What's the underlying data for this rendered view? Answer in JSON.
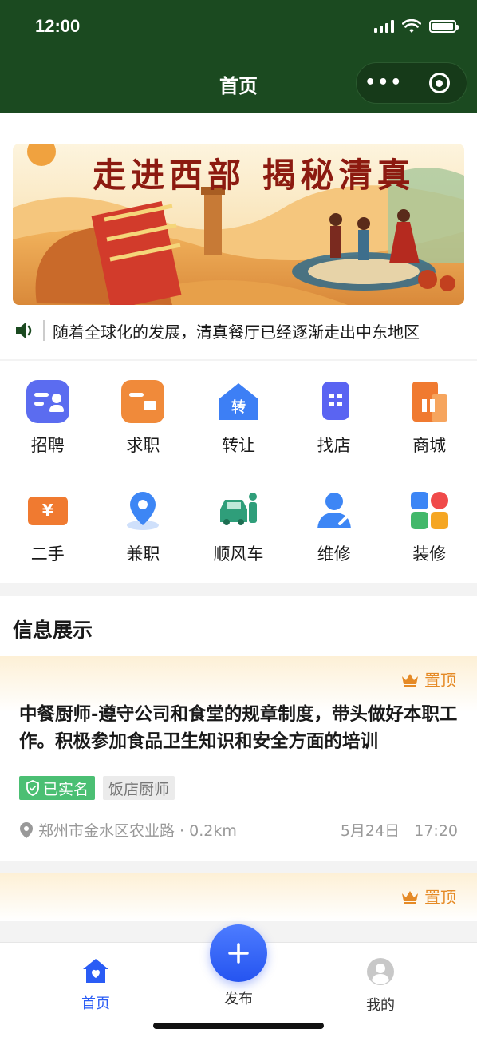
{
  "status_bar": {
    "time": "12:00"
  },
  "nav": {
    "title": "首页"
  },
  "banner": {
    "title": "走进西部 揭秘清真"
  },
  "notice": {
    "text": "随着全球化的发展，清真餐厅已经逐渐走出中东地区"
  },
  "categories": [
    {
      "label": "招聘",
      "icon": "recruit-card-icon",
      "color": "#5b6cf0"
    },
    {
      "label": "求职",
      "icon": "job-seek-briefcase-icon",
      "color": "#f08a3a"
    },
    {
      "label": "转让",
      "icon": "transfer-house-icon",
      "color": "#3d7ff5",
      "badge": "转"
    },
    {
      "label": "找店",
      "icon": "find-shop-phone-icon",
      "color": "#5a64f2"
    },
    {
      "label": "商城",
      "icon": "mall-building-icon",
      "color": "#f07a30"
    },
    {
      "label": "二手",
      "icon": "second-hand-ticket-icon",
      "color": "#f07a30",
      "badge": "¥"
    },
    {
      "label": "兼职",
      "icon": "part-time-location-icon",
      "color": "#3d86f5"
    },
    {
      "label": "顺风车",
      "icon": "rideshare-car-icon",
      "color": "#2f9e7a"
    },
    {
      "label": "维修",
      "icon": "repair-person-icon",
      "color": "#3d86f5"
    },
    {
      "label": "装修",
      "icon": "decoration-blocks-icon",
      "color": "#3d86f5"
    }
  ],
  "info": {
    "section_title": "信息展示",
    "pin_label": "置顶",
    "post": {
      "title": "中餐厨师-遵守公司和食堂的规章制度，带头做好本职工作。积极参加食品卫生知识和安全方面的培训",
      "verified": "已实名",
      "category": "饭店厨师",
      "location": "郑州市金水区农业路 · 0.2km",
      "date": "5月24日",
      "time": "17:20"
    }
  },
  "tabbar": {
    "home": "首页",
    "post": "发布",
    "me": "我的"
  },
  "colors": {
    "header": "#1b4a20",
    "accent": "#2a5cf5",
    "pin": "#e58a26",
    "verified": "#4bbf73"
  }
}
